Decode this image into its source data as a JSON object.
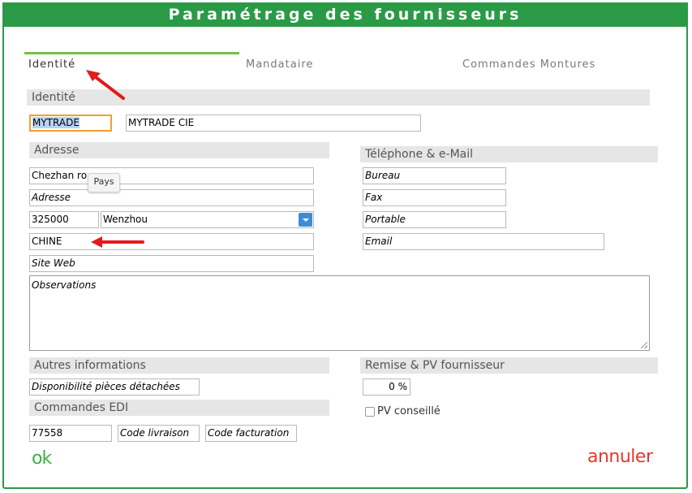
{
  "window": {
    "title": "Paramétrage des fournisseurs"
  },
  "tabs": [
    {
      "label": "Identité",
      "active": true
    },
    {
      "label": "Mandataire",
      "active": false
    },
    {
      "label": "Commandes Montures",
      "active": false
    }
  ],
  "identite": {
    "section_title": "Identité",
    "code": "MYTRADE",
    "name": "MYTRADE CIE"
  },
  "adresse": {
    "section_title": "Adresse",
    "line1": "Chezhan ro",
    "line2_placeholder": "Adresse",
    "postal_code": "325000",
    "city": "Wenzhou",
    "country": "CHINE",
    "website_placeholder": "Site Web",
    "tooltip": "Pays"
  },
  "telephone": {
    "section_title": "Téléphone & e-Mail",
    "bureau_placeholder": "Bureau",
    "fax_placeholder": "Fax",
    "portable_placeholder": "Portable",
    "email_placeholder": "Email"
  },
  "observations_placeholder": "Observations",
  "autres": {
    "section_title": "Autres informations",
    "dispo_placeholder": "Disponibilité pièces détachées"
  },
  "edi": {
    "section_title": "Commandes EDI",
    "code": "77558",
    "livraison_placeholder": "Code livraison",
    "facturation_placeholder": "Code facturation"
  },
  "remise": {
    "section_title": "Remise & PV fournisseur",
    "value": "0 %",
    "pv_label": "PV conseillé",
    "pv_checked": false
  },
  "actions": {
    "ok": "ok",
    "cancel": "annuler"
  },
  "colors": {
    "header_green": "#2b9a47",
    "tab_underline": "#7bc043",
    "ok_green": "#3cb043",
    "cancel_red": "#e8382a",
    "arrow_red": "#e21b1b"
  }
}
